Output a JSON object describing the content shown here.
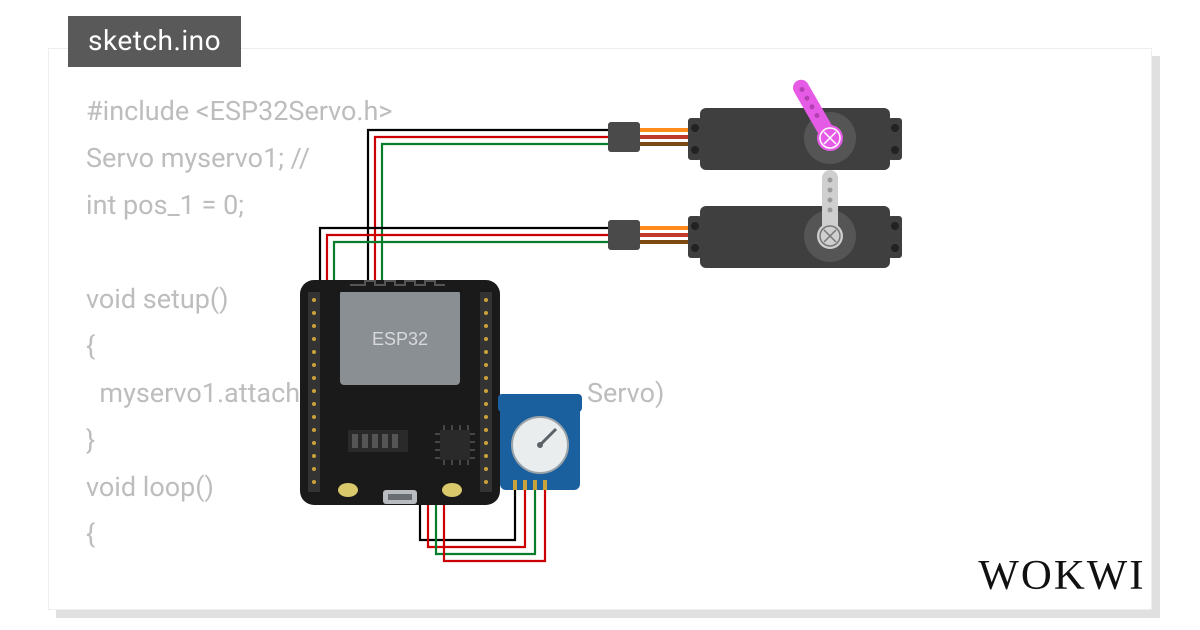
{
  "tab_label": "sketch.ino",
  "brand": "WOKWI",
  "code_text": "#include <ESP32Servo.h>\nServo myservo1; //\nint pos_1 = 0;\n\nvoid setup()\n{\n  myservo1.attach(13); /                                Servo)\n}\nvoid loop()\n{",
  "components": {
    "board": {
      "label": "ESP32",
      "usb": "USB"
    },
    "servo_top": {
      "horn_color": "#e65be6"
    },
    "servo_bottom": {
      "horn_color": "#cfcfcf"
    },
    "rtc_module": {
      "color": "#1a5f9e"
    }
  },
  "wires": [
    {
      "color": "black",
      "from": "esp32-gnd",
      "to": "servo1-gnd"
    },
    {
      "color": "red",
      "from": "esp32-vin",
      "to": "servo1-vcc"
    },
    {
      "color": "green",
      "from": "esp32-d13",
      "to": "servo1-sig"
    },
    {
      "color": "black",
      "from": "esp32-gnd",
      "to": "servo2-gnd"
    },
    {
      "color": "red",
      "from": "esp32-vin",
      "to": "servo2-vcc"
    },
    {
      "color": "green",
      "from": "esp32-d12",
      "to": "servo2-sig"
    },
    {
      "color": "black",
      "from": "esp32-gnd",
      "to": "rtc-gnd"
    },
    {
      "color": "red",
      "from": "esp32-3v3",
      "to": "rtc-vcc"
    },
    {
      "color": "green",
      "from": "esp32-sda",
      "to": "rtc-sda"
    },
    {
      "color": "red",
      "from": "esp32-scl",
      "to": "rtc-scl"
    }
  ]
}
